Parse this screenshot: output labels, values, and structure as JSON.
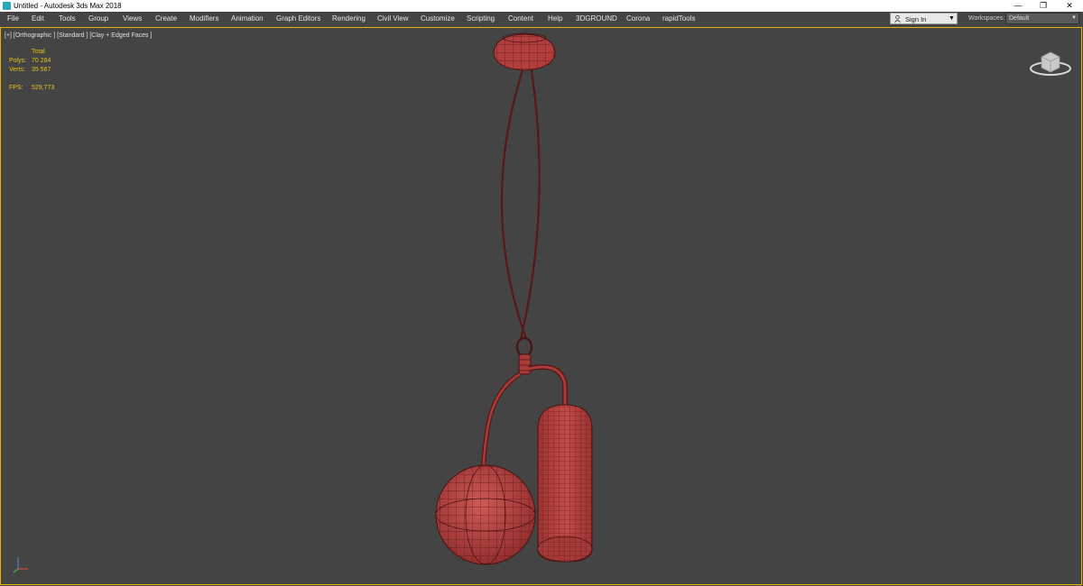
{
  "window": {
    "title": "Untitled - Autodesk 3ds Max 2018",
    "minimize_icon": "—",
    "restore_icon": "❐",
    "close_icon": "✕"
  },
  "menu": [
    {
      "label": "File"
    },
    {
      "label": "Edit"
    },
    {
      "label": "Tools"
    },
    {
      "label": "Group"
    },
    {
      "label": "Views"
    },
    {
      "label": "Create"
    },
    {
      "label": "Modifiers"
    },
    {
      "label": "Animation"
    },
    {
      "label": "Graph Editors"
    },
    {
      "label": "Rendering"
    },
    {
      "label": "Civil View"
    },
    {
      "label": "Customize"
    },
    {
      "label": "Scripting"
    },
    {
      "label": "Content"
    },
    {
      "label": "Help"
    },
    {
      "label": "3DGROUND"
    },
    {
      "label": "Corona"
    },
    {
      "label": "rapidTools"
    }
  ],
  "account": {
    "signin_label": "Sign In",
    "workspaces_label": "Workspaces:",
    "workspace_value": "Default"
  },
  "viewport": {
    "label": "[+] [Orthographic ] [Standard ] [Clay + Edged Faces ]",
    "stats": {
      "total_header": "Total",
      "polys_label": "Polys:",
      "polys_value": "70 264",
      "verts_label": "Verts:",
      "verts_value": "35 567",
      "fps_label": "FPS:",
      "fps_value": "529,773"
    }
  },
  "colors": {
    "viewport_bg": "#444444",
    "active_border": "#e8b400",
    "stats_text": "#e8c21a",
    "model_fill": "#b8413f",
    "wire": "#4a1212"
  },
  "icons": {
    "app": "3ds-max-icon",
    "user": "user-icon",
    "viewcube": "viewcube-icon",
    "axis": "axis-tripod-icon"
  }
}
